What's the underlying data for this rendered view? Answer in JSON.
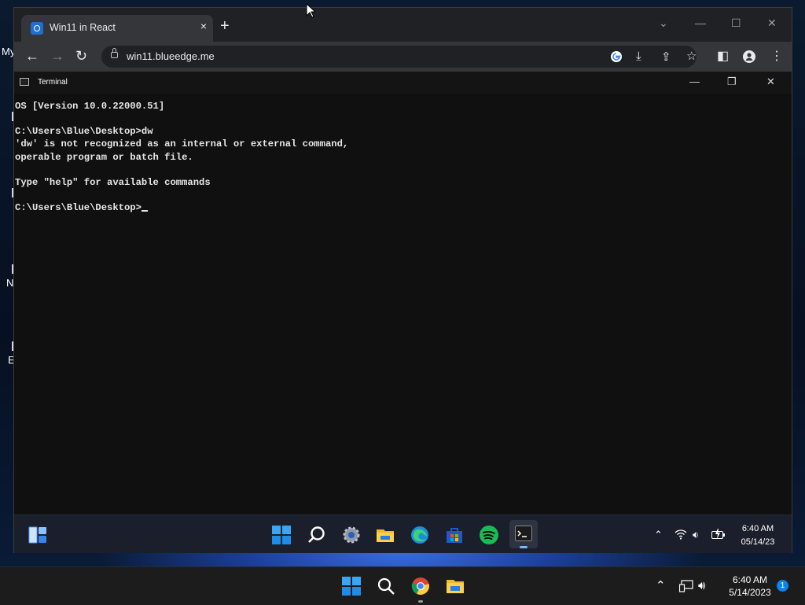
{
  "desktop": {
    "fragments": [
      "My",
      "N",
      "E"
    ]
  },
  "chrome": {
    "tab_title": "Win11 in React",
    "tab_close": "×",
    "new_tab": "+",
    "url": "win11.blueedge.me",
    "controls": {
      "chevron": "⌄",
      "minimize": "—",
      "maximize": "☐",
      "close": "✕"
    }
  },
  "terminal": {
    "title": "Terminal",
    "lines": [
      "OS [Version 10.0.22000.51]",
      "",
      "C:\\Users\\Blue\\Desktop>dw",
      "'dw' is not recognized as an internal or external command,",
      "operable program or batch file.",
      "",
      "Type \"help\" for available commands",
      "",
      "C:\\Users\\Blue\\Desktop>"
    ],
    "controls": {
      "minimize": "—",
      "maximize": "❐",
      "close": "✕"
    }
  },
  "inner_taskbar": {
    "time": "6:40 AM",
    "date": "05/14/23",
    "apps": [
      "start",
      "search",
      "settings",
      "file-explorer",
      "edge",
      "store",
      "spotify",
      "terminal"
    ]
  },
  "host_taskbar": {
    "time": "6:40 AM",
    "date": "5/14/2023",
    "notification_count": "1",
    "apps": [
      "start",
      "search",
      "chrome",
      "file-explorer"
    ]
  },
  "colors": {
    "accent": "#0078d4",
    "chrome_dark": "#202124",
    "chrome_toolbar": "#35363a",
    "terminal_bg": "#101010",
    "spotify": "#1db954"
  }
}
